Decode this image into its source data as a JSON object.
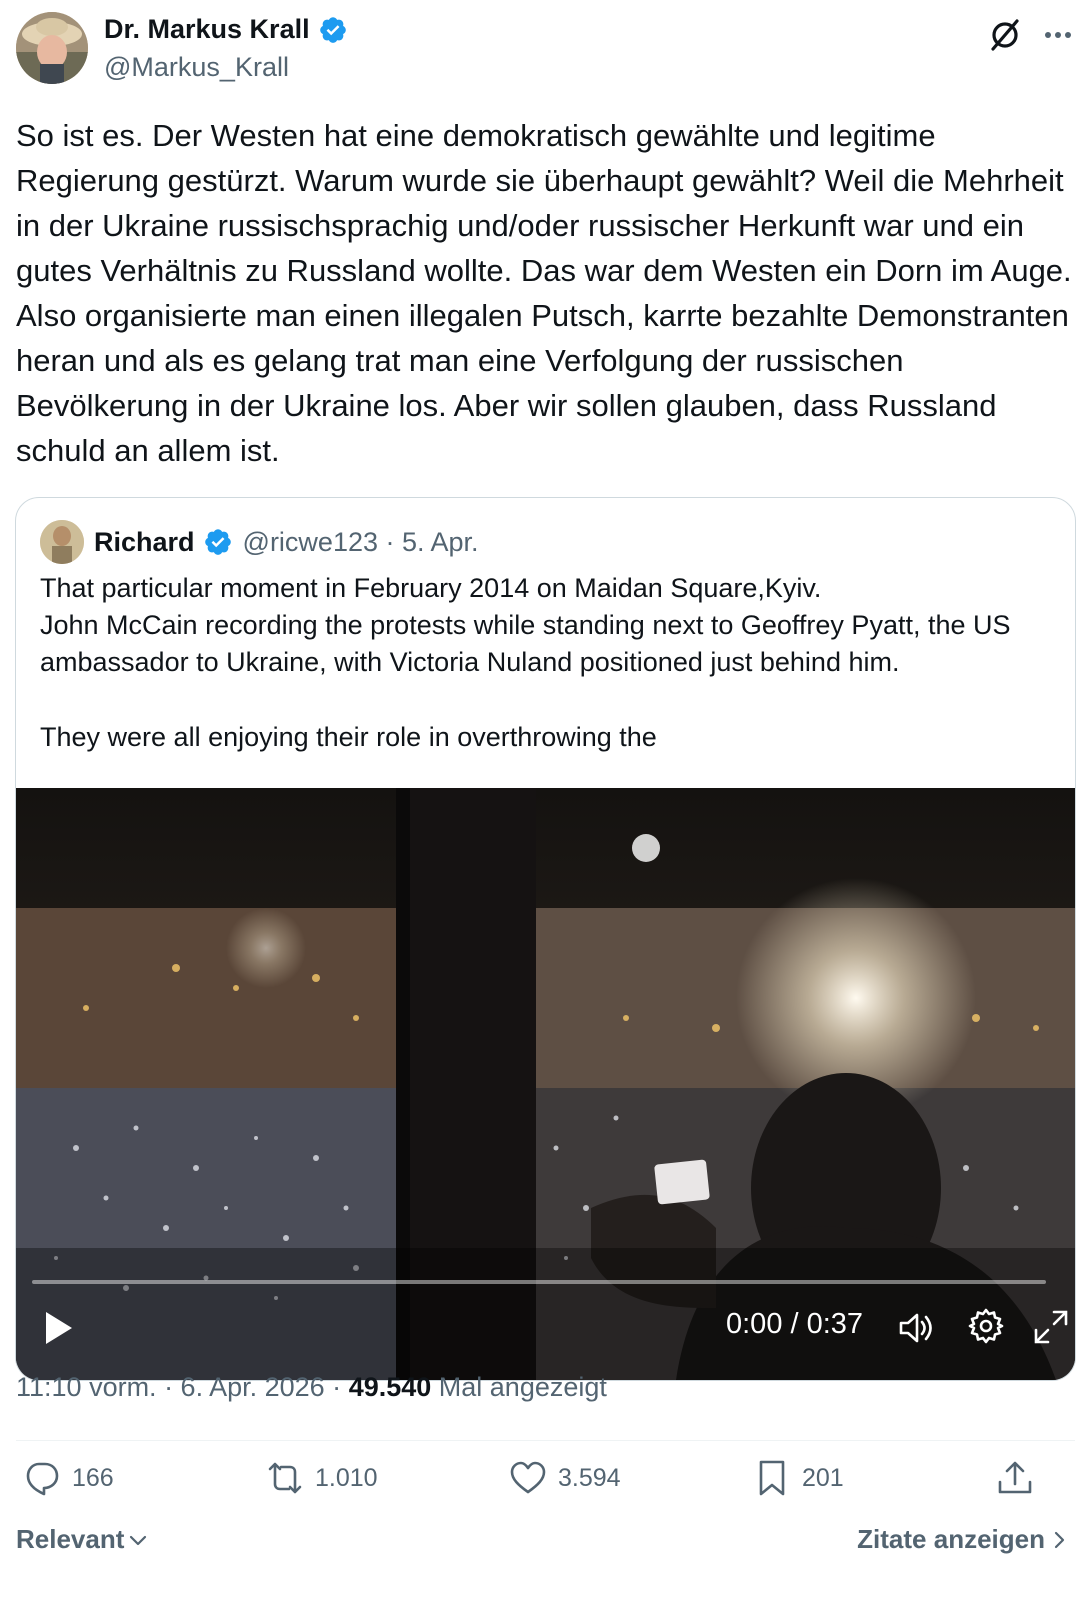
{
  "author": {
    "name": "Dr. Markus Krall",
    "handle": "@Markus_Krall",
    "verified": true
  },
  "tweet": {
    "text": "So ist es. Der Westen hat eine demokratisch gewählte und legitime Regierung gestürzt. Warum wurde sie überhaupt gewählt? Weil die Mehrheit in der Ukraine russischsprachig und/oder russischer Herkunft war und ein gutes Verhältnis zu Russland wollte. Das war dem Westen ein Dorn im Auge. Also organisierte man einen illegalen Putsch, karrte bezahlte Demonstranten heran und als es gelang trat man eine Verfolgung der russischen Bevölkerung in der Ukraine los. Aber wir sollen glauben, dass Russland schuld an allem ist."
  },
  "quote": {
    "name": "Richard",
    "handle_date": "@ricwe123 · 5. Apr.",
    "line1": "That particular moment in February 2014 on Maidan Square,Kyiv.",
    "line2": "John McCain recording the protests while standing next to Geoffrey Pyatt, the US ambassador to Ukraine, with Victoria Nuland positioned just behind him.",
    "line3": "They were all enjoying their role in overthrowing the",
    "video": {
      "time": "0:00 / 0:37",
      "progress": 0
    }
  },
  "meta": {
    "time_date": "11:10 vorm. · 6. Apr. 2026 · ",
    "views": "49.540",
    "views_label": " Mal angezeigt"
  },
  "actions": {
    "replies": "166",
    "reposts": "1.010",
    "likes": "3.594",
    "bookmarks": "201"
  },
  "footer": {
    "sort_label": "Relevant",
    "quotes_label": "Zitate anzeigen"
  },
  "colors": {
    "verified": "#1d9bf0",
    "secondary_text": "#536471",
    "text": "#0f1419"
  }
}
